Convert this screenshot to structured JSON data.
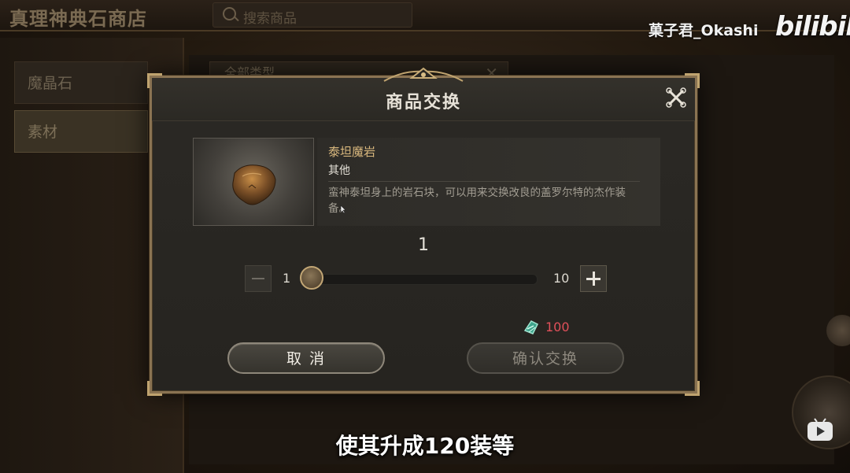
{
  "background": {
    "shop_title": "真理神典石商店",
    "search_placeholder": "搜索商品",
    "categories": [
      {
        "label": "魔晶石",
        "active": false
      },
      {
        "label": "素材",
        "active": true
      }
    ],
    "filter_label": "全部类型"
  },
  "watermark": {
    "user": "菓子君_Okashi",
    "logo": "bilibili"
  },
  "dialog": {
    "title": "商品交换",
    "item": {
      "name": "泰坦魔岩",
      "category": "其他",
      "description": "蛮神泰坦身上的岩石块，可以用来交换改良的盖罗尔特的杰作装备。"
    },
    "quantity": {
      "value": "1",
      "min": "1",
      "max": "10",
      "fraction": 0
    },
    "price": {
      "amount": "100",
      "icon": "currency-gem-icon",
      "color": "#e0505a"
    },
    "cancel_label": "取 消",
    "confirm_label": "确认交换"
  },
  "subtitle": "使其升成120装等",
  "colors": {
    "frame_gold": "#bfa36f",
    "item_name": "#d8b77d"
  }
}
